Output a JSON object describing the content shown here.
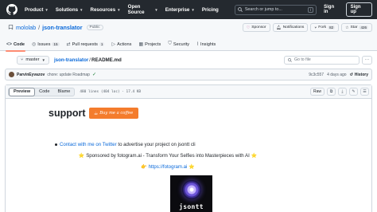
{
  "nav": {
    "links": [
      "Product",
      "Solutions",
      "Resources",
      "Open Source",
      "Enterprise",
      "Pricing"
    ],
    "search_placeholder": "Search or jump to...",
    "search_key": "/",
    "signin": "Sign in",
    "signup": "Sign up"
  },
  "repo": {
    "owner": "mololab",
    "separator": "/",
    "name": "json-translator",
    "visibility": "Public",
    "buttons": {
      "sponsor": "Sponsor",
      "notifications": "Notifications",
      "fork": "Fork",
      "fork_count": "82",
      "star": "Star",
      "star_count": "426"
    },
    "tabs": [
      {
        "label": "Code",
        "count": ""
      },
      {
        "label": "Issues",
        "count": "15"
      },
      {
        "label": "Pull requests",
        "count": "1"
      },
      {
        "label": "Actions",
        "count": ""
      },
      {
        "label": "Projects",
        "count": ""
      },
      {
        "label": "Security",
        "count": ""
      },
      {
        "label": "Insights",
        "count": ""
      }
    ]
  },
  "filebar": {
    "branch": "master",
    "crumb_repo": "json-translator",
    "crumb_sep": "/",
    "crumb_file": "README.md",
    "goto_placeholder": "Go to file"
  },
  "commit": {
    "author": "ParvinEyvazov",
    "message": "chore: update Roadmap",
    "hash": "9c3c557",
    "age": "4 days ago",
    "history": "History"
  },
  "file": {
    "views": [
      "Preview",
      "Code",
      "Blame"
    ],
    "info": "480 lines (404 loc) · 17.4 KB",
    "raw": "Raw"
  },
  "readme": {
    "title": "support",
    "bmc_label": "Buy me a coffee",
    "contact_link": "Contact with me on Twitter",
    "contact_rest": " to advertise your project on jsontt cli",
    "sponsor_line": "⭐ Sponsored by fotogram.ai - Transform Your Selfies into Masterpieces with AI ⭐",
    "sponsor_link_prefix": "👉 ",
    "sponsor_link": "https://fotogram.ai",
    "sponsor_link_suffix": " ⭐",
    "logo_text": "jsontt"
  }
}
